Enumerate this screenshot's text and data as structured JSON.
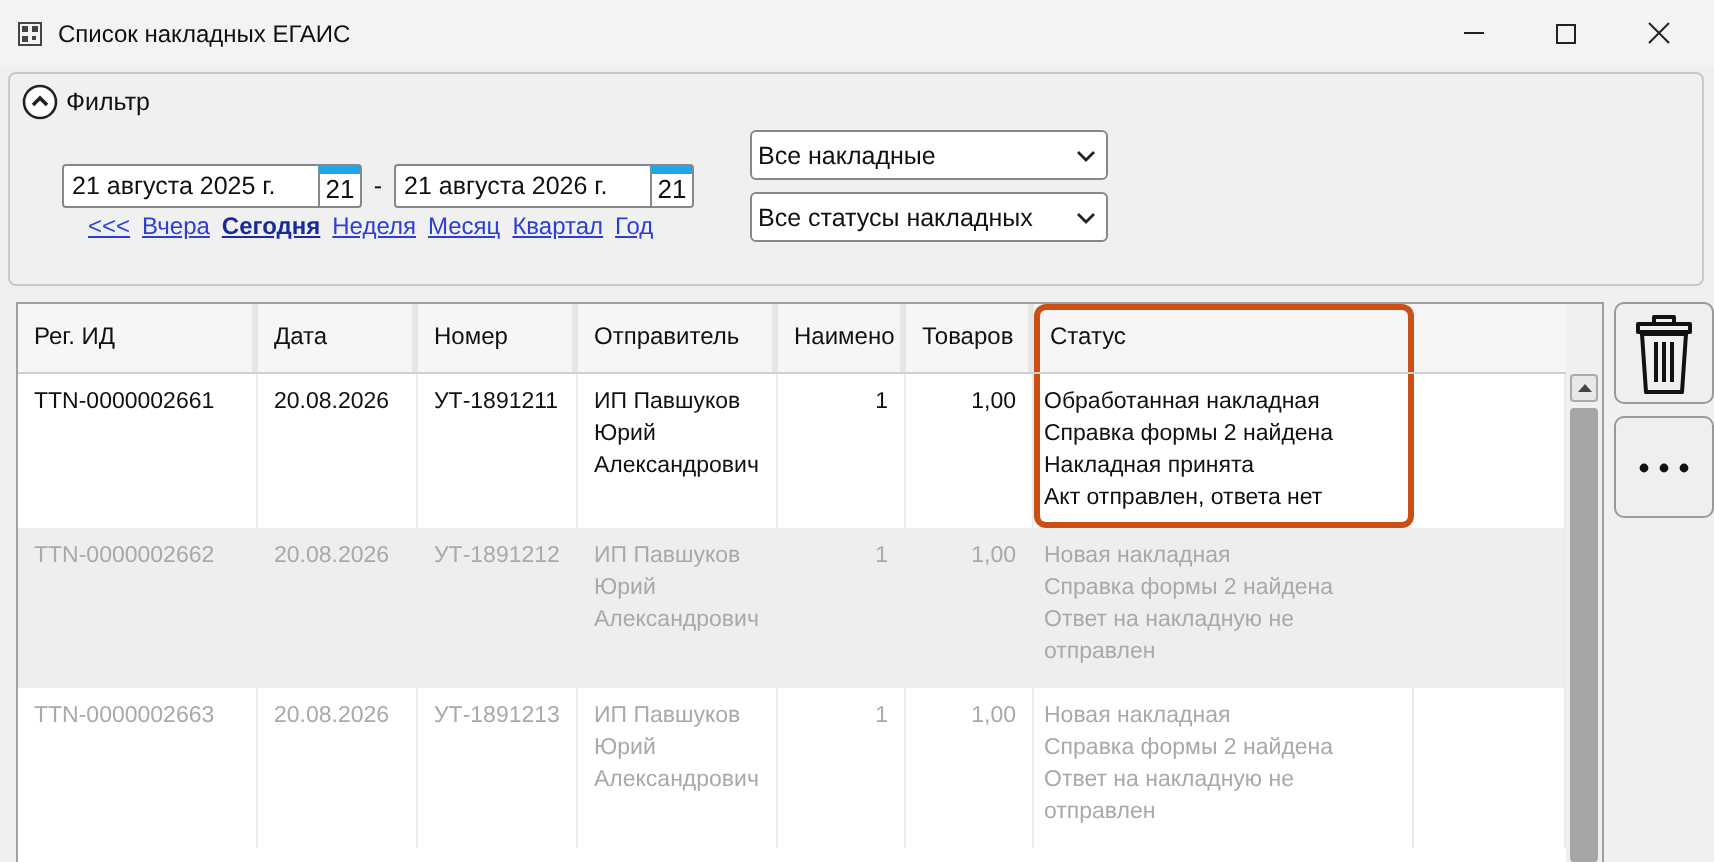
{
  "window": {
    "title": "Список накладных ЕГАИС"
  },
  "filter": {
    "title": "Фильтр",
    "expanded": true,
    "date_from": {
      "value": "21 августа 2025 г.",
      "calendar_day": "21"
    },
    "separator": "-",
    "date_to": {
      "value": "21 августа 2026 г.",
      "calendar_day": "21"
    },
    "periods": [
      {
        "label": "<<<",
        "selected": false
      },
      {
        "label": "Вчера",
        "selected": false
      },
      {
        "label": "Сегодня",
        "selected": true
      },
      {
        "label": "Неделя",
        "selected": false
      },
      {
        "label": "Месяц",
        "selected": false
      },
      {
        "label": "Квартал",
        "selected": false
      },
      {
        "label": "Год",
        "selected": false
      }
    ],
    "invoice_type": {
      "value": "Все накладные"
    },
    "status_filter": {
      "value": "Все статусы накладных"
    }
  },
  "table": {
    "columns": [
      {
        "label": "Рег. ИД",
        "numeric": false,
        "highlighted": false
      },
      {
        "label": "Дата",
        "numeric": false,
        "highlighted": false
      },
      {
        "label": "Номер",
        "numeric": false,
        "highlighted": false
      },
      {
        "label": "Отправитель",
        "numeric": false,
        "highlighted": false
      },
      {
        "label": "Наимено",
        "numeric": true,
        "highlighted": false
      },
      {
        "label": "Товаров",
        "numeric": true,
        "highlighted": false
      },
      {
        "label": "Статус",
        "numeric": false,
        "highlighted": true
      }
    ],
    "rows": [
      {
        "cells": [
          "TTN-0000002661",
          "20.08.2026",
          "УТ-1891211",
          "ИП Павшуков Юрий Александрович",
          "1",
          "1,00"
        ],
        "status": [
          "Обработанная накладная",
          "Справка формы 2 найдена",
          "Накладная принята",
          "Акт отправлен, ответа нет"
        ],
        "blurred": false,
        "highlighted": true
      },
      {
        "cells": [
          "TTN-0000002662",
          "20.08.2026",
          "УТ-1891212",
          "ИП Павшуков Юрий Александрович",
          "1",
          "1,00"
        ],
        "status": [
          "Новая накладная",
          "Справка формы 2 найдена",
          "Ответ на накладную не отправлен"
        ],
        "blurred": true,
        "highlighted": false
      },
      {
        "cells": [
          "TTN-0000002663",
          "20.08.2026",
          "УТ-1891213",
          "ИП Павшуков Юрий Александрович",
          "1",
          "1,00"
        ],
        "status": [
          "Новая накладная",
          "Справка формы 2 найдена",
          "Ответ на накладную не отправлен"
        ],
        "blurred": true,
        "highlighted": false
      }
    ]
  }
}
